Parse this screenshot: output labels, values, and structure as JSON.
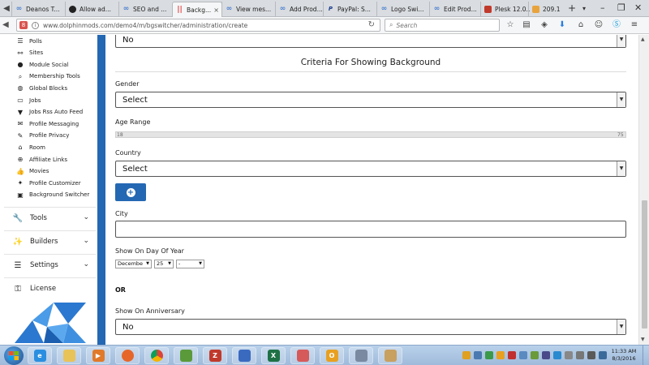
{
  "browser": {
    "tabs": [
      {
        "label": "Deanos T...",
        "icon": "loop"
      },
      {
        "label": "Allow ad...",
        "icon": "gh"
      },
      {
        "label": "SEO and ...",
        "icon": "loop"
      },
      {
        "label": "Backg...",
        "icon": "bar",
        "active": true,
        "close": "×"
      },
      {
        "label": "View mes...",
        "icon": "loop"
      },
      {
        "label": "Add Prod...",
        "icon": "loop"
      },
      {
        "label": "PayPal: S...",
        "icon": "pp"
      },
      {
        "label": "Logo Swi...",
        "icon": "loop"
      },
      {
        "label": "Edit Prod...",
        "icon": "loop"
      },
      {
        "label": "Plesk 12.0...",
        "icon": "plesk"
      },
      {
        "label": "209.1",
        "icon": "num"
      }
    ],
    "new_tab": "+",
    "url": "www.dolphinmods.com/demo4/m/bgswitcher/administration/create",
    "search_placeholder": "Search"
  },
  "sidebar": {
    "items": [
      {
        "label": "Polls",
        "icon": "list-icon"
      },
      {
        "label": "Sites",
        "icon": "link-icon"
      },
      {
        "label": "Module Social",
        "icon": "circle-icon"
      },
      {
        "label": "Membership Tools",
        "icon": "search-icon"
      },
      {
        "label": "Global Blocks",
        "icon": "globe-icon"
      },
      {
        "label": "Jobs",
        "icon": "card-icon"
      },
      {
        "label": "Jobs Rss Auto Feed",
        "icon": "filter-icon"
      },
      {
        "label": "Profile Messaging",
        "icon": "envelope-icon"
      },
      {
        "label": "Profile Privacy",
        "icon": "pencil-icon"
      },
      {
        "label": "Room",
        "icon": "home-icon"
      },
      {
        "label": "Affiliate Links",
        "icon": "search-plus-icon"
      },
      {
        "label": "Movies",
        "icon": "thumbs-up-icon"
      },
      {
        "label": "Profile Customizer",
        "icon": "magic-icon"
      },
      {
        "label": "Background Switcher",
        "icon": "picture-icon"
      }
    ],
    "sections": [
      {
        "label": "Tools",
        "icon": "wrench-icon"
      },
      {
        "label": "Builders",
        "icon": "magic-wand-icon"
      },
      {
        "label": "Settings",
        "icon": "sliders-icon"
      },
      {
        "label": "License",
        "icon": "key-icon"
      }
    ]
  },
  "form": {
    "top_select_value": "No",
    "section_title": "Criteria For Showing Background",
    "gender_label": "Gender",
    "gender_value": "Select",
    "age_label": "Age Range",
    "age_min": "18",
    "age_max": "75",
    "country_label": "Country",
    "country_value": "Select",
    "add_button_icon": "+",
    "city_label": "City",
    "city_value": "",
    "day_label": "Show On Day Of Year",
    "day_month": "Decembe",
    "day_day": "25",
    "day_extra": "-",
    "or_label": "OR",
    "anniversary_label": "Show On Anniversary",
    "anniversary_value": "No"
  },
  "taskbar": {
    "time": "11:33 AM",
    "date": "8/3/2016"
  },
  "colors": {
    "accent_blue": "#2468b3",
    "sidebar_strip": "#2468b3"
  }
}
